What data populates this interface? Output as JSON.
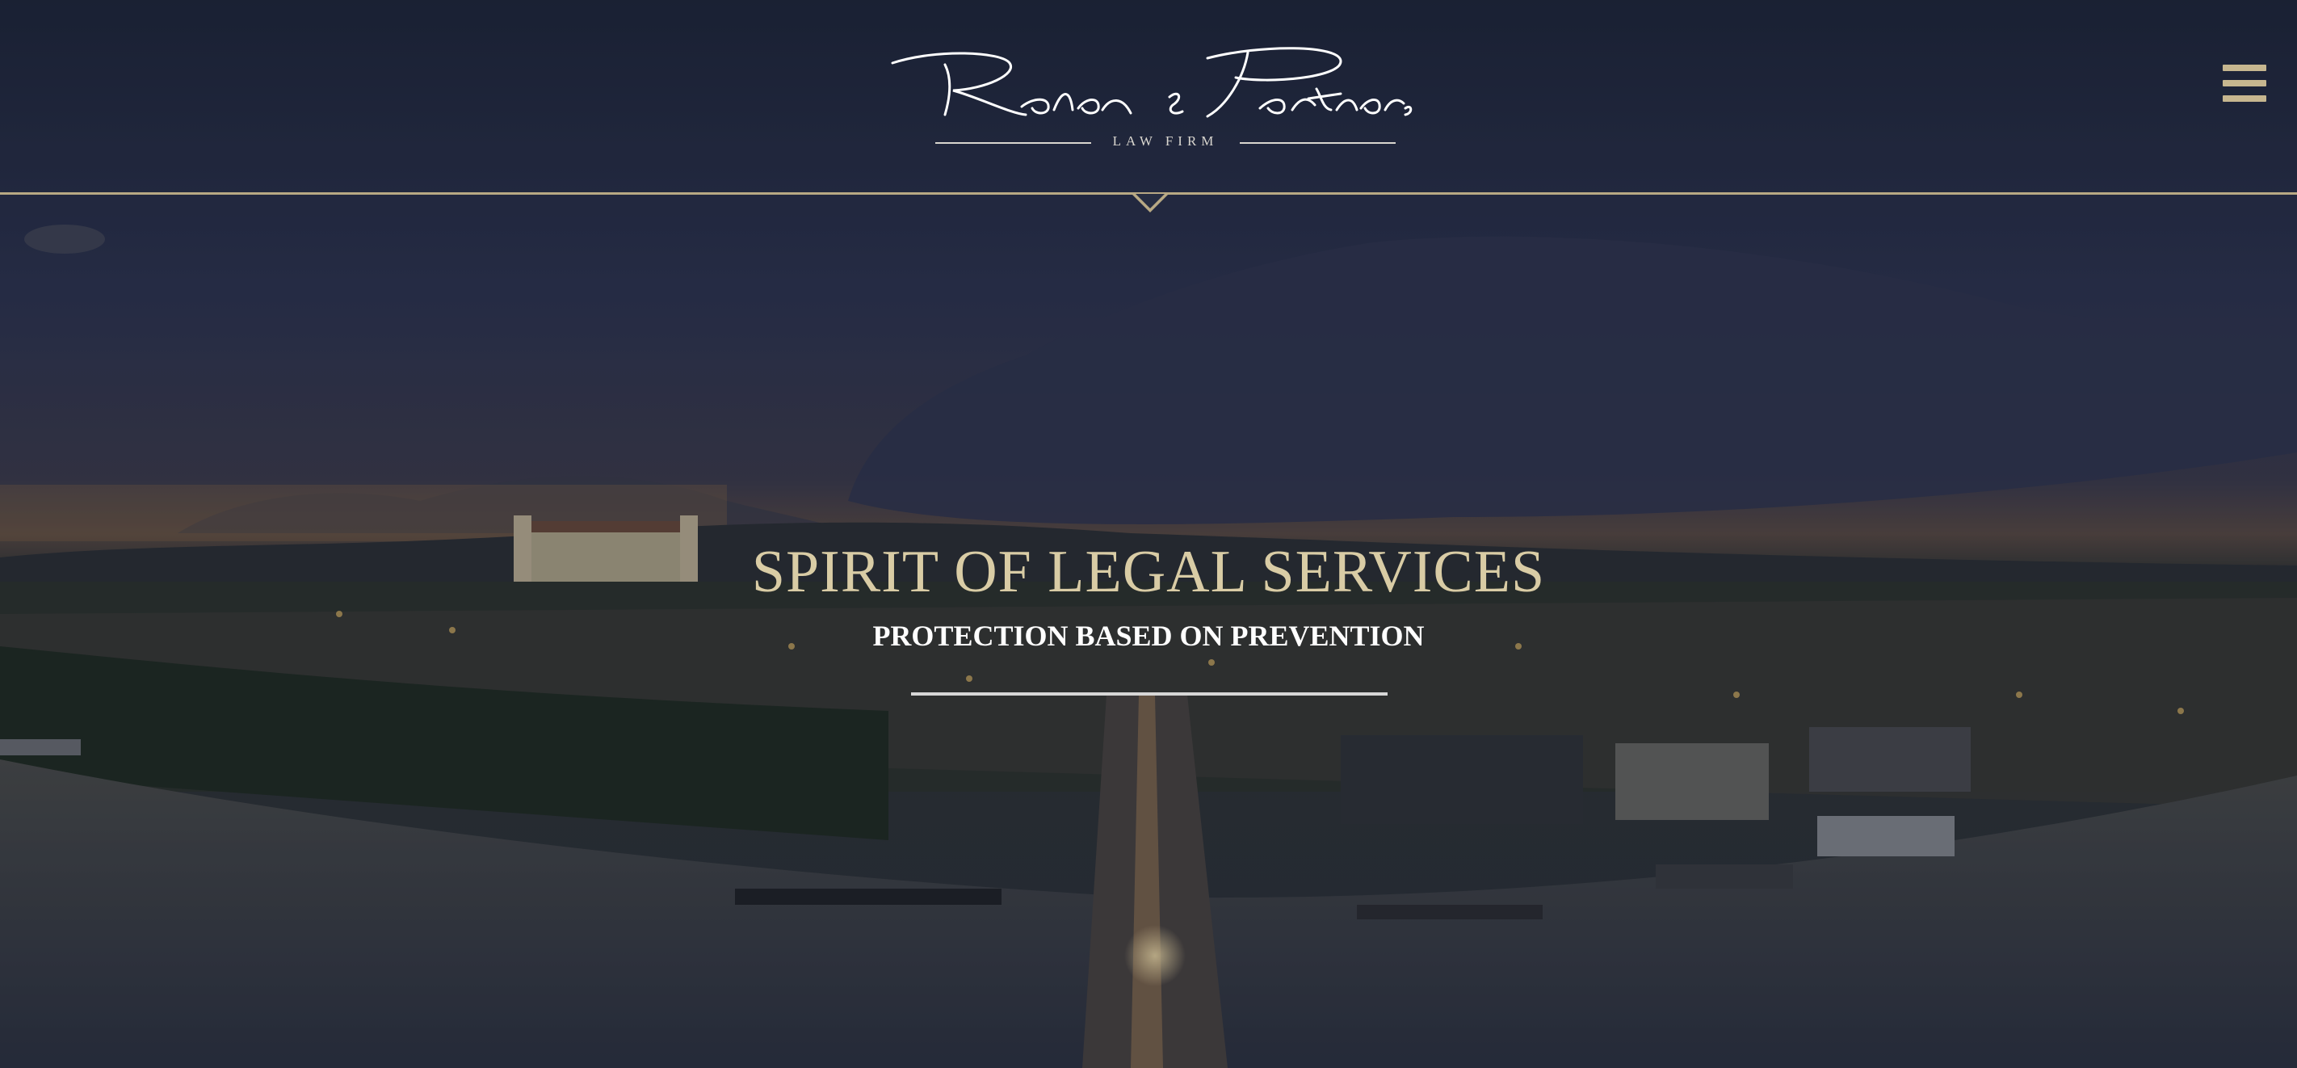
{
  "brand": {
    "logo_script": "Reben & Partners",
    "logo_subtitle": "LAW FIRM"
  },
  "hero": {
    "title": "SPIRIT OF LEGAL SERVICES",
    "subtitle": "PROTECTION BASED ON PREVENTION"
  },
  "header": {
    "menu_icon": "hamburger-menu-icon"
  },
  "colors": {
    "accent_gold": "#b8a984",
    "title_gold": "#d9cca5",
    "white": "#ffffff"
  }
}
